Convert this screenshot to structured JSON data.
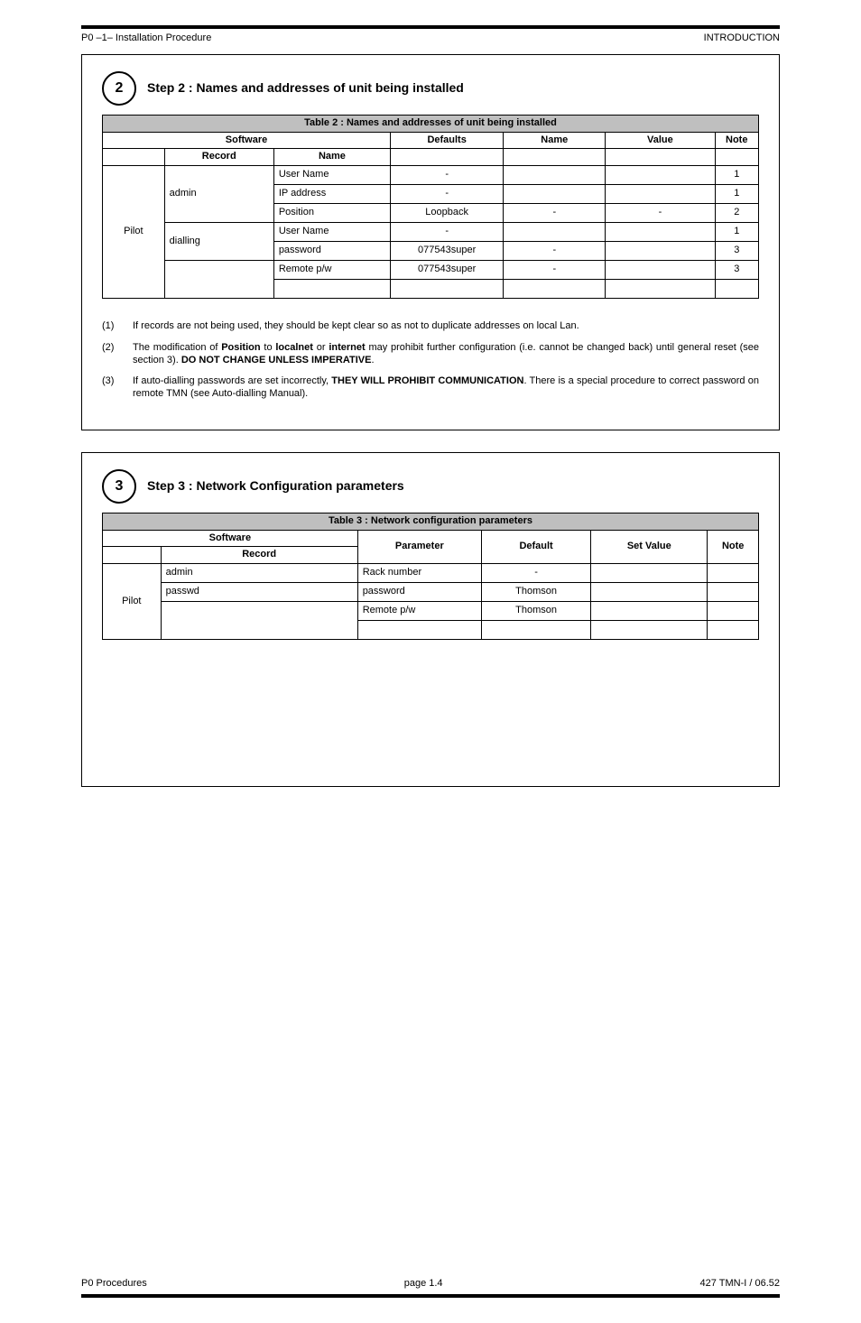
{
  "header": {
    "left": "P0 –1– Installation Procedure",
    "right": "INTRODUCTION"
  },
  "footer": {
    "left": "P0 Procedures",
    "center": "page 1.4",
    "right": "427 TMN-I / 06.52"
  },
  "step2": {
    "num": "2",
    "title": "Step 2 : Names and addresses of unit being installed",
    "table_title": "Table 2 :  Names and addresses of unit being installed",
    "cols": {
      "software": "Software",
      "record": "Record",
      "name": "Name",
      "defaults": "Defaults",
      "name2": "Name",
      "value": "Value",
      "note": "Note"
    },
    "groups": [
      {
        "group": "Pilot",
        "rows": [
          {
            "rec": "admin",
            "name": "User Name",
            "def": "-",
            "name2": "",
            "val": "",
            "note": "1"
          },
          {
            "rec": "admin",
            "name": "IP address",
            "def": "-",
            "name2": "",
            "val": "",
            "note": "1"
          },
          {
            "rec": "admin",
            "name": "Position",
            "def": "Loopback",
            "name2": "-",
            "val": "-",
            "note": "2"
          },
          {
            "rec": "dialling",
            "name": "User Name",
            "def": "-",
            "name2": "",
            "val": "",
            "note": "1"
          },
          {
            "rec": "dialling",
            "name": "password",
            "def": "077543super",
            "name2": "-",
            "val": "",
            "note": "3"
          },
          {
            "rec": "",
            "name": "Remote p/w",
            "def": "077543super",
            "name2": "-",
            "val": "",
            "note": "3"
          }
        ]
      }
    ],
    "notes": [
      {
        "n": "(1)",
        "html": "If records are not being used, they should be kept clear so as not to duplicate addresses on local Lan."
      },
      {
        "n": "(2)",
        "html": "The modification of <b>Position</b> to <b>localnet</b> or <b>internet</b> may prohibit further configuration (i.e. cannot be changed back) until general reset (see section 3). <b>DO NOT CHANGE UNLESS IMPERATIVE</b>."
      },
      {
        "n": "(3)",
        "html": "If auto-dialling passwords are set incorrectly, <b>THEY WILL PROHIBIT COMMUNICATION</b>. There is a special procedure to correct password on remote TMN (see Auto-dialling Manual)."
      }
    ]
  },
  "step3": {
    "num": "3",
    "title": "Step 3 : Network Configuration parameters",
    "table_title": "Table 3 :  Network configuration parameters",
    "cols": {
      "software": "Software",
      "record": "Record",
      "parameter": "Parameter",
      "default": "Default",
      "setvalue": "Set Value",
      "note": "Note"
    },
    "groups": [
      {
        "group": "Pilot",
        "rows": [
          {
            "rec": "admin",
            "param": "Rack number",
            "def": "-",
            "val": "",
            "note": ""
          },
          {
            "rec": "passwd",
            "param": "password",
            "def": "Thomson",
            "val": "",
            "note": ""
          },
          {
            "rec": "",
            "param": "Remote p/w",
            "def": "Thomson",
            "val": "",
            "note": ""
          }
        ]
      }
    ]
  }
}
